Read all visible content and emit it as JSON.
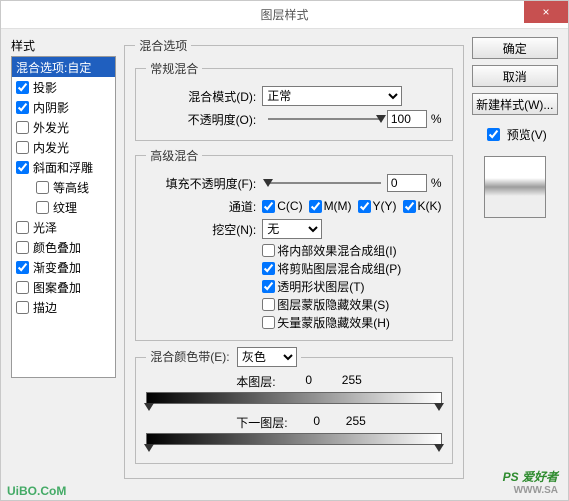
{
  "window": {
    "title": "图层样式"
  },
  "close_glyph": "×",
  "left": {
    "label": "样式",
    "items": [
      {
        "label": "混合选项:自定",
        "checked": null,
        "selected": true,
        "indent": false
      },
      {
        "label": "投影",
        "checked": true,
        "selected": false,
        "indent": false
      },
      {
        "label": "内阴影",
        "checked": true,
        "selected": false,
        "indent": false
      },
      {
        "label": "外发光",
        "checked": false,
        "selected": false,
        "indent": false
      },
      {
        "label": "内发光",
        "checked": false,
        "selected": false,
        "indent": false
      },
      {
        "label": "斜面和浮雕",
        "checked": true,
        "selected": false,
        "indent": false
      },
      {
        "label": "等高线",
        "checked": false,
        "selected": false,
        "indent": true
      },
      {
        "label": "纹理",
        "checked": false,
        "selected": false,
        "indent": true
      },
      {
        "label": "光泽",
        "checked": false,
        "selected": false,
        "indent": false
      },
      {
        "label": "颜色叠加",
        "checked": false,
        "selected": false,
        "indent": false
      },
      {
        "label": "渐变叠加",
        "checked": true,
        "selected": false,
        "indent": false
      },
      {
        "label": "图案叠加",
        "checked": false,
        "selected": false,
        "indent": false
      },
      {
        "label": "描边",
        "checked": false,
        "selected": false,
        "indent": false
      }
    ]
  },
  "mid": {
    "group_title": "混合选项",
    "normal": {
      "legend": "常规混合",
      "mode_label": "混合模式(D):",
      "mode_value": "正常",
      "opacity_label": "不透明度(O):",
      "opacity_value": "100",
      "opacity_unit": "%"
    },
    "advanced": {
      "legend": "高级混合",
      "fill_label": "填充不透明度(F):",
      "fill_value": "0",
      "fill_unit": "%",
      "channel_label": "通道:",
      "channels": [
        {
          "label": "C(C)",
          "checked": true
        },
        {
          "label": "M(M)",
          "checked": true
        },
        {
          "label": "Y(Y)",
          "checked": true
        },
        {
          "label": "K(K)",
          "checked": true
        }
      ],
      "knock_label": "挖空(N):",
      "knock_value": "无",
      "opts": [
        {
          "label": "将内部效果混合成组(I)",
          "checked": false
        },
        {
          "label": "将剪贴图层混合成组(P)",
          "checked": true
        },
        {
          "label": "透明形状图层(T)",
          "checked": true
        },
        {
          "label": "图层蒙版隐藏效果(S)",
          "checked": false
        },
        {
          "label": "矢量蒙版隐藏效果(H)",
          "checked": false
        }
      ]
    },
    "blendif": {
      "legend": "混合颜色带(E):",
      "select_value": "灰色",
      "this_label": "本图层:",
      "this_lo": "0",
      "this_hi": "255",
      "under_label": "下一图层:",
      "under_lo": "0",
      "under_hi": "255"
    }
  },
  "right": {
    "ok": "确定",
    "cancel": "取消",
    "newstyle": "新建样式(W)...",
    "preview_label": "预览(V)",
    "preview_checked": true
  },
  "watermark": {
    "line1": "PS 爱好者",
    "line2": "WWW.SA"
  },
  "footer": "UiBO.CoM"
}
